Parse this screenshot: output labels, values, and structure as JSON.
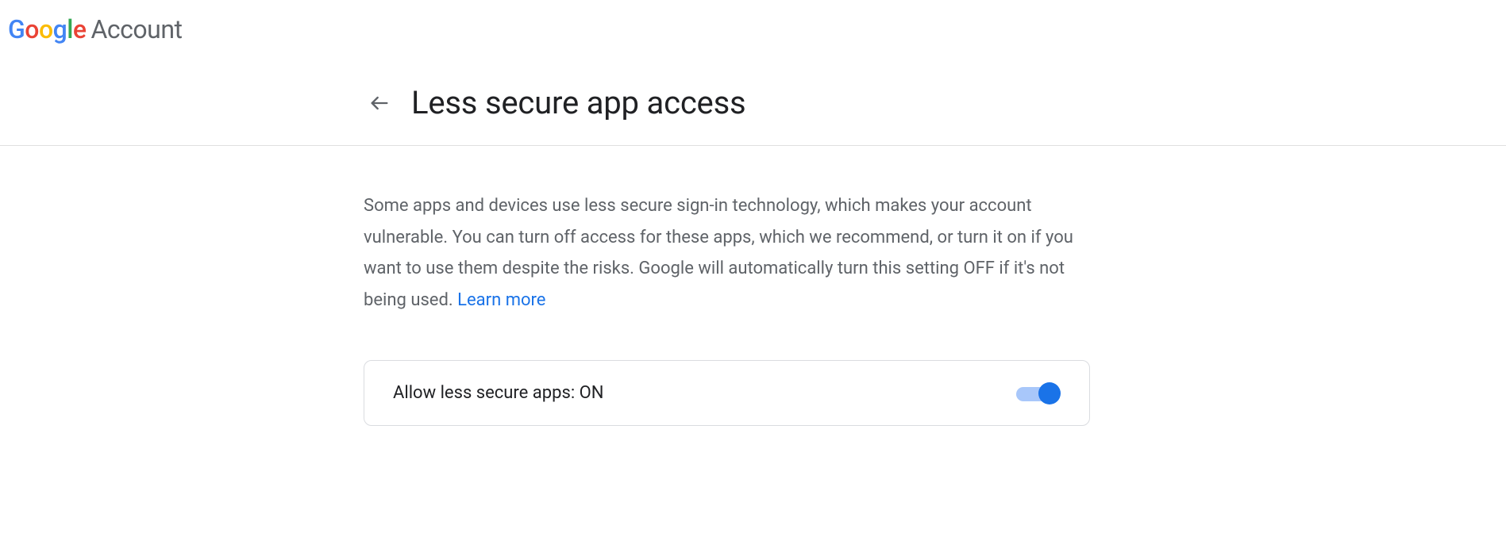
{
  "header": {
    "brand_account": "Account"
  },
  "page": {
    "title": "Less secure app access",
    "description": "Some apps and devices use less secure sign-in technology, which makes your account vulnerable. You can turn off access for these apps, which we recommend, or turn it on if you want to use them despite the risks. Google will automatically turn this setting OFF if it's not being used. ",
    "learn_more": "Learn more"
  },
  "setting": {
    "label": "Allow less secure apps: ON",
    "state": "on"
  }
}
